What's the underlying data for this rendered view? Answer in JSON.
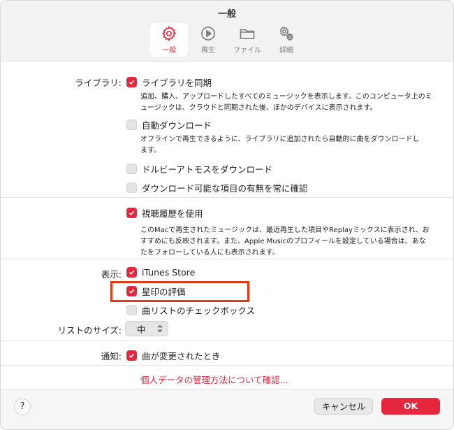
{
  "window": {
    "title": "一般"
  },
  "tabs": [
    {
      "label": "一般",
      "icon": "gear-icon",
      "selected": true
    },
    {
      "label": "再生",
      "icon": "play-icon",
      "selected": false
    },
    {
      "label": "ファイル",
      "icon": "folder-icon",
      "selected": false
    },
    {
      "label": "詳細",
      "icon": "gears-icon",
      "selected": false
    }
  ],
  "library": {
    "section_label": "ライブラリ:",
    "sync": {
      "label": "ライブラリを同期",
      "checked": true,
      "desc_line1": "追加、購入、アップロードしたすべてのミュージックを表示します。このコンピュータ上のミ",
      "desc_line2": "ュージックは、クラウドと同期された後、ほかのデバイスに表示されます。"
    },
    "auto_download": {
      "label": "自動ダウンロード",
      "checked": false,
      "desc_line1": "オフラインで再生できるように、ライブラリに追加されたら自動的に曲をダウンロードし",
      "desc_line2": "ます。"
    },
    "dolby": {
      "label": "ドルビーアトモスをダウンロード",
      "checked": false
    },
    "always_check": {
      "label": "ダウンロード可能な項目の有無を常に確認",
      "checked": false
    }
  },
  "history": {
    "label": "視聴履歴を使用",
    "checked": true,
    "desc_line1": "このMacで再生されたミュージックは、最近再生した項目やReplayミックスに表示され、お",
    "desc_line2": "すすめにも反映されます。また、Apple Musicのプロフィールを設定している場合は、あな",
    "desc_line3": "たをフォローしている人にも表示されます。"
  },
  "display": {
    "section_label": "表示:",
    "itunes_store": {
      "label": "iTunes Store",
      "checked": true
    },
    "star_rating": {
      "label": "星印の評価",
      "checked": true
    },
    "song_checkboxes": {
      "label": "曲リストのチェックボックス",
      "checked": false
    }
  },
  "list_size": {
    "label": "リストのサイズ:",
    "value": "中"
  },
  "notifications": {
    "section_label": "通知:",
    "song_change": {
      "label": "曲が変更されたとき",
      "checked": true
    }
  },
  "privacy_link": "個人データの管理方法について確認...",
  "footer": {
    "help": "?",
    "cancel": "キャンセル",
    "ok": "OK"
  },
  "colors": {
    "accent": "#e5263c",
    "highlight_box": "#e23a16"
  }
}
